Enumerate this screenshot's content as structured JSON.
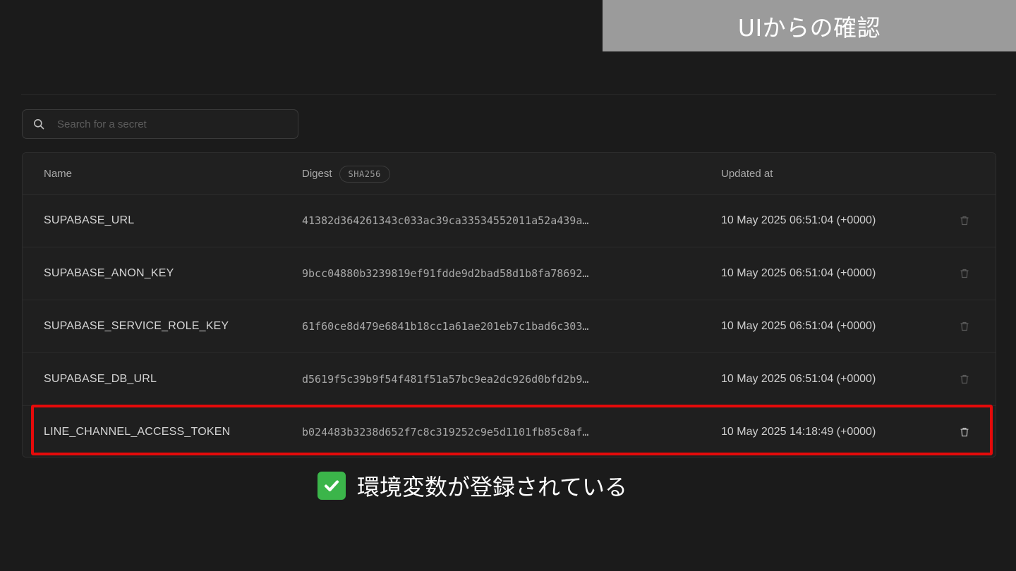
{
  "banner": {
    "title": "UIからの確認"
  },
  "search": {
    "placeholder": "Search for a secret"
  },
  "table": {
    "headers": {
      "name": "Name",
      "digest": "Digest",
      "digest_badge": "SHA256",
      "updated": "Updated at"
    },
    "rows": [
      {
        "name": "SUPABASE_URL",
        "digest": "41382d364261343c033ac39ca33534552011a52a439a…",
        "updated": "10 May 2025 06:51:04 (+0000)"
      },
      {
        "name": "SUPABASE_ANON_KEY",
        "digest": "9bcc04880b3239819ef91fdde9d2bad58d1b8fa78692…",
        "updated": "10 May 2025 06:51:04 (+0000)"
      },
      {
        "name": "SUPABASE_SERVICE_ROLE_KEY",
        "digest": "61f60ce8d479e6841b18cc1a61ae201eb7c1bad6c303…",
        "updated": "10 May 2025 06:51:04 (+0000)"
      },
      {
        "name": "SUPABASE_DB_URL",
        "digest": "d5619f5c39b9f54f481f51a57bc9ea2dc926d0bfd2b9…",
        "updated": "10 May 2025 06:51:04 (+0000)"
      },
      {
        "name": "LINE_CHANNEL_ACCESS_TOKEN",
        "digest": "b024483b3238d652f7c8c319252c9e5d1101fb85c8af…",
        "updated": "10 May 2025 14:18:49 (+0000)"
      }
    ]
  },
  "caption": {
    "text": "環境変数が登録されている"
  },
  "icons": {
    "search": "search-icon",
    "trash": "trash-icon",
    "check": "check-mark-icon"
  },
  "colors": {
    "highlight": "#e50a0a",
    "check": "#3bb54a",
    "banner": "#9b9b9b"
  }
}
